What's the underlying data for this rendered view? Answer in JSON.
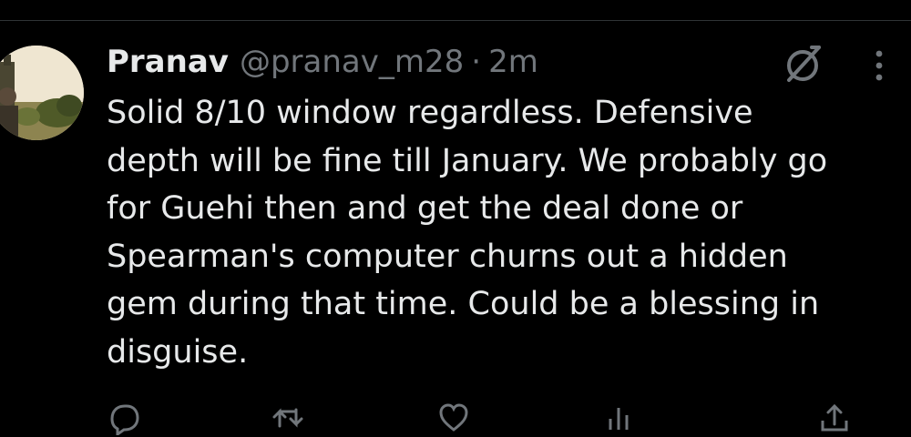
{
  "tweet": {
    "author": {
      "display_name": "Pranav",
      "handle": "@pranav_m28",
      "avatar_icon": "profile-photo"
    },
    "separator": "·",
    "timestamp": "2m",
    "text": "Solid 8/10 window regardless. Defensive\ndepth will be fine till January. We probably go\nfor Guehi then and get the deal done or\nSpearman's computer churns out a hidden\ngem during that time. Could be a blessing in\ndisguise."
  },
  "header_icons": [
    "grok-icon",
    "more-options-icon"
  ],
  "actions": {
    "reply_count": "",
    "retweet_count": "",
    "like_count": "",
    "views_count": ""
  },
  "colors": {
    "background": "#000000",
    "primary_text": "#e7e9ea",
    "secondary_text": "#71767b",
    "divider": "#2f3336"
  }
}
